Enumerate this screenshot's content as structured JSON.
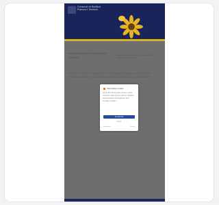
{
  "site": {
    "name": "Consorzio di Bonifica",
    "subtitle": "Pianura e Territorio"
  },
  "article": {
    "headline": "Notizie dal territorio e comunicati del Consorzio",
    "side_text": "Aggiornamenti sulle attività e sui servizi offerti ai cittadini del comprensorio.",
    "body": "Il Consorzio informa che sono disponibili sul sito i nuovi documenti relativi alla gestione delle acque e alla manutenzione dei canali. Per maggiori informazioni consultare gli uffici competenti o la sezione dedicata."
  },
  "cookie_dialog": {
    "title": "Informativa cookie",
    "body": "Questo sito utilizza cookie tecnici e, previo consenso, cookie di terze parti per migliorare la tua esperienza di navigazione. Puoi accettare o rifiutare.",
    "accept_label": "Accetta tutti",
    "reject_label": "Rifiuta",
    "link_preferences": "Preferenze",
    "link_policy": "Privacy"
  },
  "colors": {
    "header": "#18245a",
    "accent": "#d8b51c",
    "button": "#2b4a9d"
  }
}
